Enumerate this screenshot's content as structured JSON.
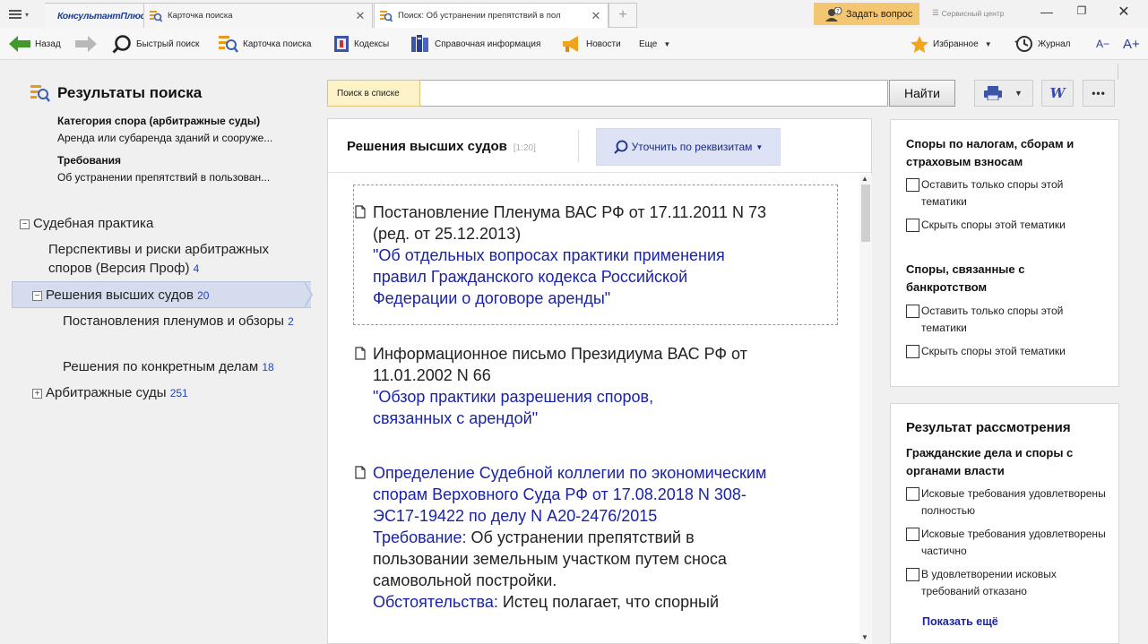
{
  "app": {
    "brand": "КонсультантПлюс",
    "tabs": [
      {
        "label": "Карточка поиска"
      },
      {
        "label": "Поиск: Об устранении препятствий в пол"
      }
    ],
    "ask_button": "Задать вопрос",
    "service_center": "Сервисный центр"
  },
  "toolbar": {
    "back": "Назад",
    "quick_search": "Быстрый поиск",
    "search_card": "Карточка поиска",
    "codes": "Кодексы",
    "reference": "Справочная информация",
    "news": "Новости",
    "more": "Еще",
    "favorites": "Избранное",
    "journal": "Журнал",
    "font_decrease": "A−",
    "font_increase": "A+"
  },
  "sidebar": {
    "title": "Результаты поиска",
    "criteria": [
      {
        "heading": "Категория спора (арбитражные суды)",
        "value": "Аренда или субаренда зданий и сооруже..."
      },
      {
        "heading": "Требования",
        "value": "Об устранении препятствий в пользован..."
      }
    ],
    "tree": {
      "root": {
        "label": "Судебная практика"
      },
      "prospects": {
        "label": "Перспективы и риски арбитражных споров (Версия Проф)",
        "count": "4"
      },
      "higher_courts": {
        "label": "Решения высших судов",
        "count": "20"
      },
      "plenums": {
        "label": "Постановления пленумов и обзоры",
        "count": "2"
      },
      "specific": {
        "label": "Решения по конкретным делам",
        "count": "18"
      },
      "arbitration": {
        "label": "Арбитражные суды",
        "count": "251"
      }
    }
  },
  "search": {
    "label": "Поиск в списке",
    "value": "",
    "placeholder": "",
    "find_button": "Найти"
  },
  "main": {
    "title": "Решения высших судов",
    "range": "[1:20]",
    "refine_button": "Уточнить по реквизитам",
    "documents": [
      {
        "line1": "Постановление Пленума ВАС РФ от 17.11.2011 N 73",
        "line2": "(ред. от 25.12.2013)",
        "link": "\"Об отдельных вопросах практики применения правил Гражданского кодекса Российской Федерации о договоре аренды\""
      },
      {
        "line1": "Информационное письмо Президиума ВАС РФ от 11.01.2002 N 66",
        "link": "\"Обзор практики разрешения споров, связанных с арендой\""
      },
      {
        "link": "Определение Судебной коллегии по экономическим спорам Верховного Суда РФ от 17.08.2018 N 308-ЭС17-19422 по делу N А20-2476/2015",
        "req_label": "Требование:",
        "req_text": " Об устранении препятствий в пользовании земельным участком путем сноса самовольной постройки.",
        "circ_label": "Обстоятельства:",
        "circ_text": " Истец полагает, что спорный"
      }
    ]
  },
  "filters": {
    "tax": {
      "title": "Споры по налогам, сборам и страховым взносам",
      "keep": "Оставить только споры этой тематики",
      "hide": "Скрыть споры этой тематики"
    },
    "bankruptcy": {
      "title": "Споры, связанные с банкротством",
      "keep": "Оставить только споры этой тематики",
      "hide": "Скрыть споры этой тематики"
    },
    "result": {
      "title": "Результат рассмотрения",
      "subtitle": "Гражданские дела и споры с органами власти",
      "options": [
        "Исковые требования удовлетворены полностью",
        "Исковые требования удовлетворены частично",
        "В удовлетворении исковых требований отказано"
      ],
      "show_more": "Показать ещё"
    }
  },
  "colors": {
    "accent_link": "#1a23a8",
    "count": "#2244bb",
    "ask_button": "#f5c672",
    "active_tree": "#d4dcee",
    "search_label": "#fdf2c8"
  }
}
